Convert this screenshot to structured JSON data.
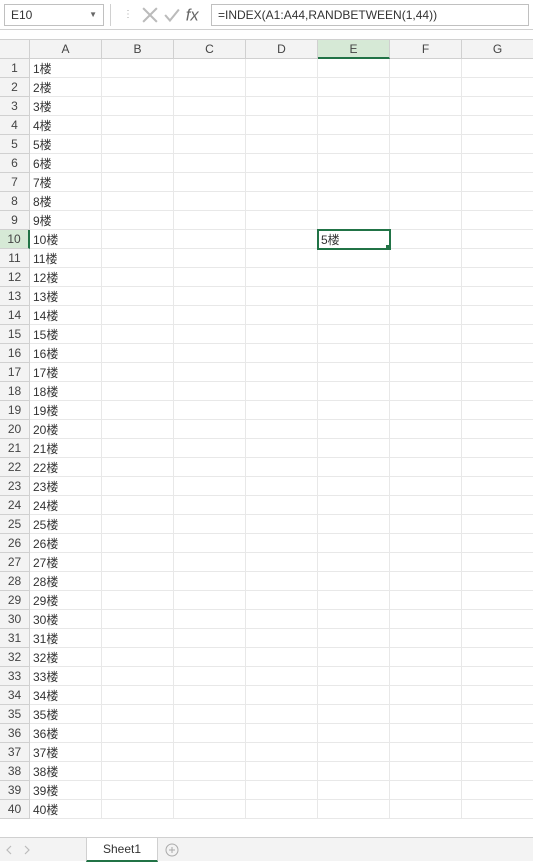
{
  "formula_bar": {
    "name_box": "E10",
    "formula": "=INDEX(A1:A44,RANDBETWEEN(1,44))"
  },
  "columns": [
    "A",
    "B",
    "C",
    "D",
    "E",
    "F",
    "G"
  ],
  "rows": [
    1,
    2,
    3,
    4,
    5,
    6,
    7,
    8,
    9,
    10,
    11,
    12,
    13,
    14,
    15,
    16,
    17,
    18,
    19,
    20,
    21,
    22,
    23,
    24,
    25,
    26,
    27,
    28,
    29,
    30,
    31,
    32,
    33,
    34,
    35,
    36,
    37,
    38,
    39,
    40
  ],
  "column_A": [
    "1楼",
    "2楼",
    "3楼",
    "4楼",
    "5楼",
    "6楼",
    "7楼",
    "8楼",
    "9楼",
    "10楼",
    "11楼",
    "12楼",
    "13楼",
    "14楼",
    "15楼",
    "16楼",
    "17楼",
    "18楼",
    "19楼",
    "20楼",
    "21楼",
    "22楼",
    "23楼",
    "24楼",
    "25楼",
    "26楼",
    "27楼",
    "28楼",
    "29楼",
    "30楼",
    "31楼",
    "32楼",
    "33楼",
    "34楼",
    "35楼",
    "36楼",
    "37楼",
    "38楼",
    "39楼",
    "40楼"
  ],
  "selected": {
    "col": "E",
    "row": 10,
    "value": "5楼"
  },
  "tabs": {
    "active": "Sheet1"
  }
}
